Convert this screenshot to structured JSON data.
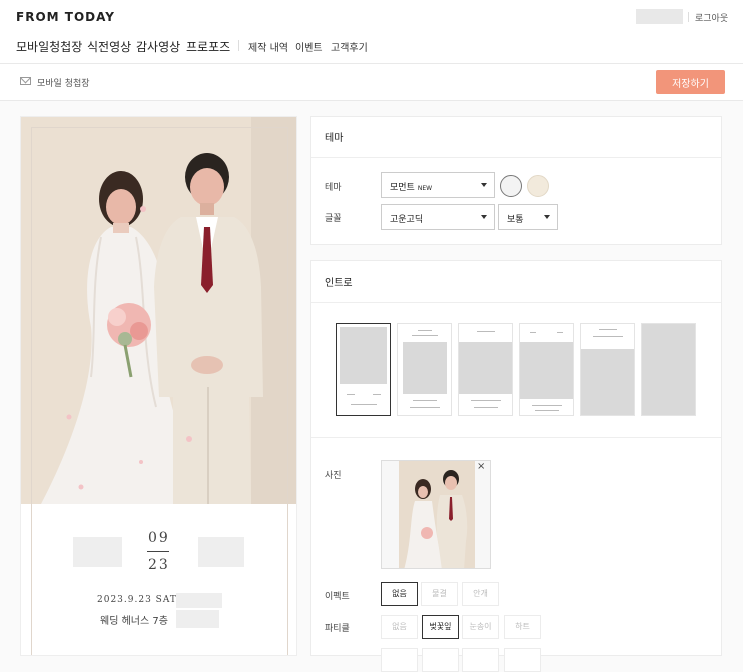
{
  "brand": {
    "logo": "FROM TODAY"
  },
  "header": {
    "logout": "로그아웃"
  },
  "nav": {
    "main": [
      "모바일청첩장",
      "식전영상",
      "감사영상",
      "프로포즈"
    ],
    "sub": [
      "제작 내역",
      "이벤트",
      "고객후기"
    ]
  },
  "subheader": {
    "crumb": "모바일 청첩장",
    "save": "저장하기"
  },
  "preview": {
    "month": "09",
    "day": "23",
    "date": "2023.9.23 SAT",
    "venue": "웨딩 헤너스 7층"
  },
  "theme": {
    "title": "테마",
    "theme_label": "테마",
    "theme_value": "모먼트",
    "theme_badge": "NEW",
    "font_label": "글꼴",
    "font_value": "고운고딕",
    "weight_value": "보통",
    "swatches": [
      "#f3f3f3",
      "#f2eadc"
    ]
  },
  "intro": {
    "title": "인트로"
  },
  "photo": {
    "label": "사진",
    "close": "×"
  },
  "effect": {
    "label": "이펙트",
    "options": [
      "없음",
      "물결",
      "안개"
    ],
    "selected": 0
  },
  "particle": {
    "label": "파티클",
    "options": [
      "없음",
      "벚꽃잎",
      "눈송이",
      "하트"
    ],
    "selected": 1
  },
  "colors": {
    "accent": "#f2957a"
  }
}
